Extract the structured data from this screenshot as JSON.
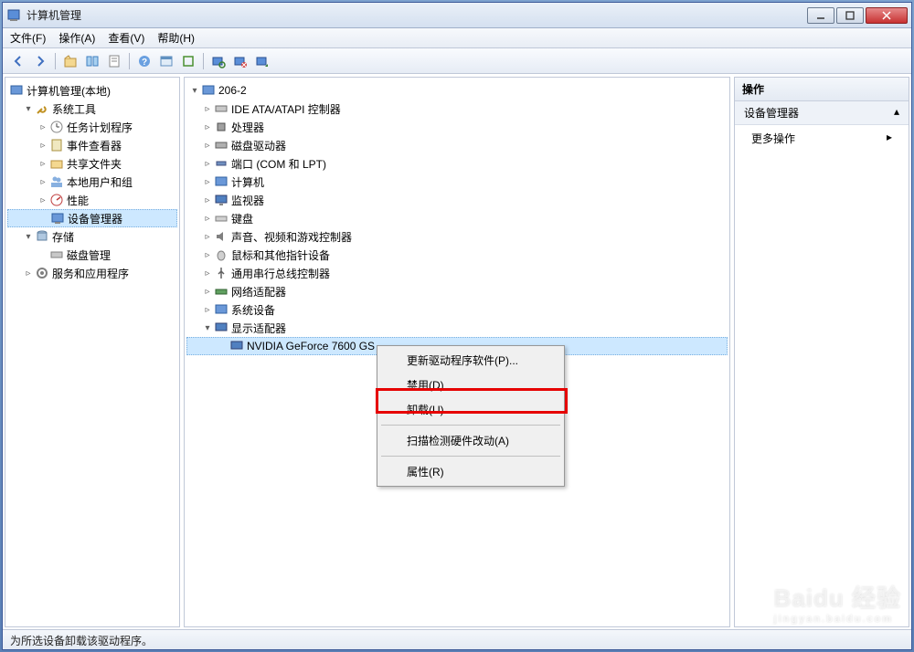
{
  "window": {
    "title": "计算机管理"
  },
  "menu": {
    "file": "文件(F)",
    "action": "操作(A)",
    "view": "查看(V)",
    "help": "帮助(H)"
  },
  "left_tree": {
    "root": "计算机管理(本地)",
    "system_tools": "系统工具",
    "task_scheduler": "任务计划程序",
    "event_viewer": "事件查看器",
    "shared_folders": "共享文件夹",
    "local_users": "本地用户和组",
    "performance": "性能",
    "device_manager": "设备管理器",
    "storage": "存储",
    "disk_mgmt": "磁盘管理",
    "services": "服务和应用程序"
  },
  "center_tree": {
    "root": "206-2",
    "ide": "IDE ATA/ATAPI 控制器",
    "cpu": "处理器",
    "disk": "磁盘驱动器",
    "ports": "端口 (COM 和 LPT)",
    "computer": "计算机",
    "monitor": "监视器",
    "keyboard": "键盘",
    "sound": "声音、视频和游戏控制器",
    "mouse": "鼠标和其他指针设备",
    "usb": "通用串行总线控制器",
    "network": "网络适配器",
    "system": "系统设备",
    "display": "显示适配器",
    "gpu": "NVIDIA GeForce 7600 GS"
  },
  "context_menu": {
    "update": "更新驱动程序软件(P)...",
    "disable": "禁用(D)",
    "uninstall": "卸载(U)",
    "scan": "扫描检测硬件改动(A)",
    "properties": "属性(R)"
  },
  "right_panel": {
    "header": "操作",
    "section": "设备管理器",
    "more": "更多操作"
  },
  "statusbar": "为所选设备卸载该驱动程序。",
  "watermark": {
    "main": "Baidu 经验",
    "sub": "jingyan.baidu.com"
  }
}
